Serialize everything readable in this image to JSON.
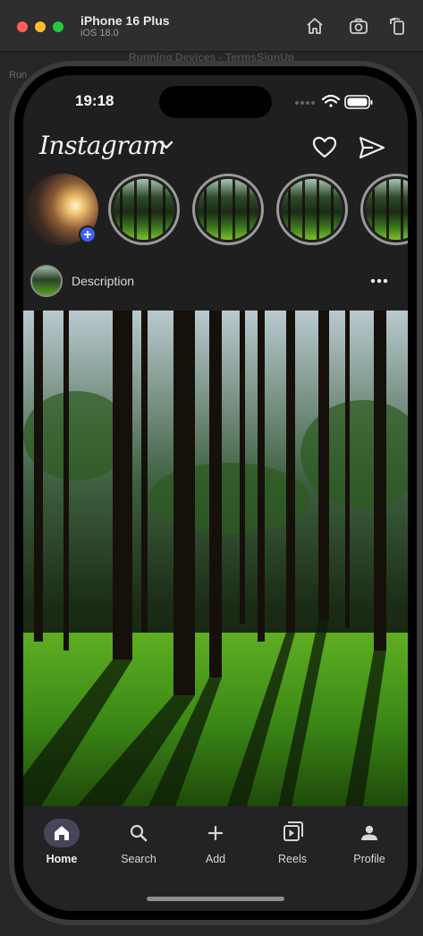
{
  "window": {
    "device_name": "iPhone 16 Plus",
    "os_version": "iOS 18.0",
    "background_title": "Running Devices - TermsSignUp",
    "background_tab": "Run"
  },
  "status_bar": {
    "time": "19:18"
  },
  "header": {
    "logo_text": "Instagram"
  },
  "stories": [
    {
      "kind": "own-story"
    },
    {
      "kind": "story"
    },
    {
      "kind": "story"
    },
    {
      "kind": "story"
    },
    {
      "kind": "story"
    }
  ],
  "post": {
    "description": "Description"
  },
  "bottom_nav": {
    "items": [
      {
        "label": "Home",
        "icon": "home-icon",
        "active": true
      },
      {
        "label": "Search",
        "icon": "search-icon",
        "active": false
      },
      {
        "label": "Add",
        "icon": "add-icon",
        "active": false
      },
      {
        "label": "Reels",
        "icon": "reels-icon",
        "active": false
      },
      {
        "label": "Profile",
        "icon": "profile-icon",
        "active": false
      }
    ]
  },
  "colors": {
    "active_nav_pill": "#4a4458",
    "add_story_badge": "#3e63f5",
    "screen_background": "#1f1f1f"
  }
}
